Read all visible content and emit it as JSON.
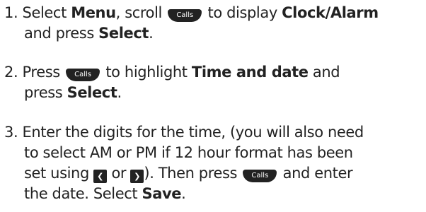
{
  "instructions": {
    "calls_key_label": "Calls",
    "left_key_icon": "chevron-left-icon",
    "right_key_icon": "chevron-right-icon",
    "left_key_glyph": "❮",
    "right_key_glyph": "❯",
    "steps": [
      {
        "number": "1.",
        "t1": "Select ",
        "b1": "Menu",
        "t2": ", scroll ",
        "t3": " to display ",
        "b2": "Clock/Alarm",
        "t4": "and press ",
        "b3": "Select",
        "t5": "."
      },
      {
        "number": "2.",
        "t1": "Press ",
        "t2": " to highlight ",
        "b1": "Time and date",
        "t3": " and",
        "t4": "press ",
        "b2": "Select",
        "t5": "."
      },
      {
        "number": "3.",
        "t1": "Enter the digits for the time, (you will also need",
        "t2": "to select AM or PM if 12 hour format has been",
        "t3": "set using ",
        "t4": " or ",
        "t5": "). Then press ",
        "t6": " and enter",
        "t7": "the date. Select ",
        "b1": "Save",
        "t8": "."
      }
    ]
  }
}
